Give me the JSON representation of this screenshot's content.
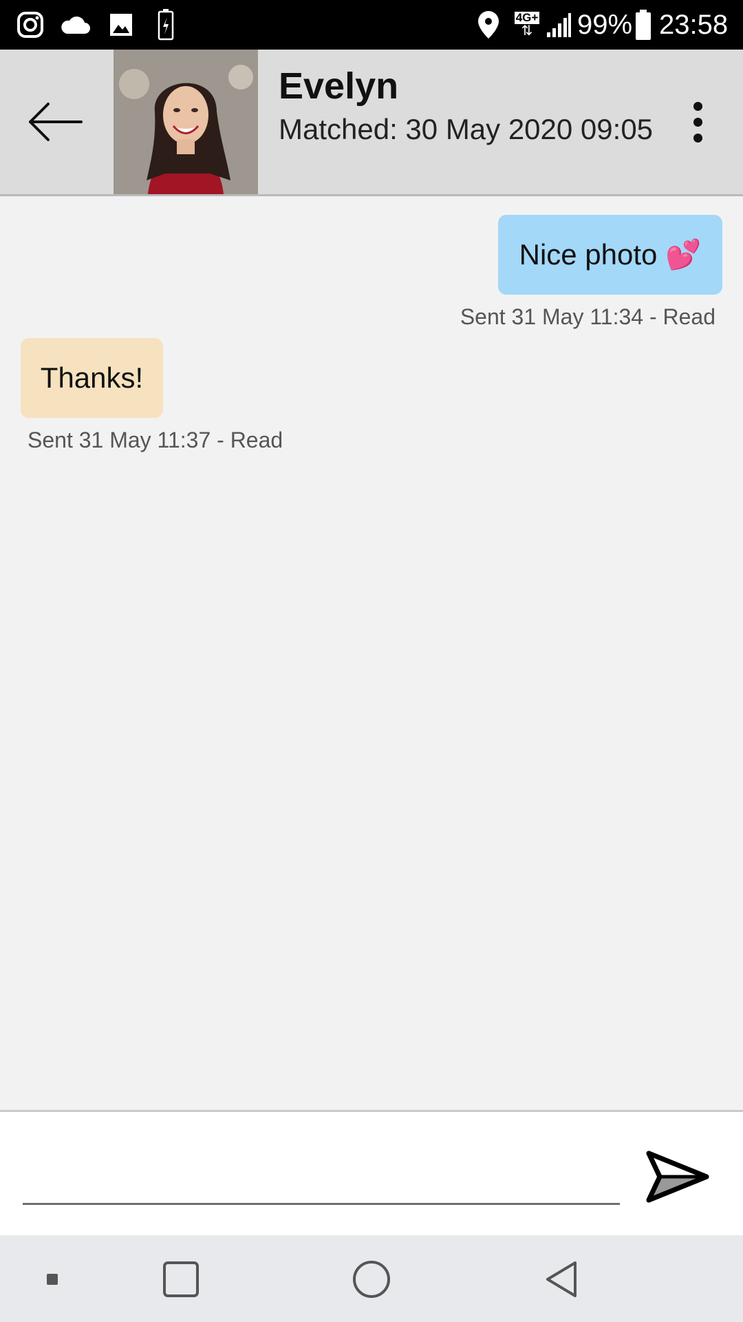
{
  "status_bar": {
    "left_icons": [
      "instagram-icon",
      "cloud-icon",
      "gallery-icon",
      "battery-charging-icon"
    ],
    "network": "4G+",
    "battery_percent": "99%",
    "time": "23:58"
  },
  "header": {
    "name": "Evelyn",
    "matched": "Matched: 30 May 2020 09:05"
  },
  "messages": [
    {
      "direction": "outgoing",
      "text": "Nice photo 💕",
      "meta": "Sent 31 May 11:34 - Read"
    },
    {
      "direction": "incoming",
      "text": "Thanks!",
      "meta": "Sent 31 May 11:37 - Read"
    }
  ],
  "composer": {
    "value": "",
    "placeholder": ""
  },
  "colors": {
    "outgoing_bubble": "#a3d8f9",
    "incoming_bubble": "#f6e2bf",
    "header_bg": "#dcdcdd",
    "chat_bg": "#f2f2f3"
  }
}
